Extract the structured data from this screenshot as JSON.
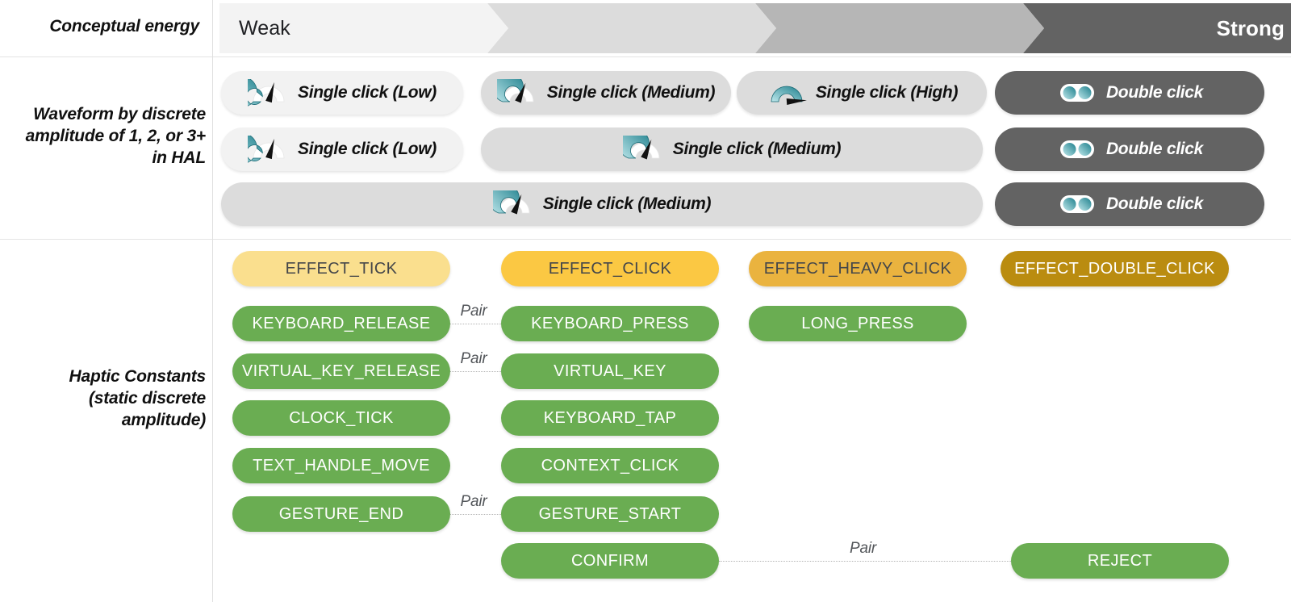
{
  "rows": {
    "energy": {
      "label": "Conceptual energy"
    },
    "waveform": {
      "label_line1": "Waveform by discrete",
      "label_line2": "amplitude of 1, 2, or 3+",
      "label_line3": "in HAL"
    },
    "constants": {
      "label_line1": "Haptic Constants",
      "label_line2": "(static discrete",
      "label_line3": "amplitude)"
    }
  },
  "energy_band": {
    "segments": [
      {
        "label": "Weak",
        "color": "#f3f3f3",
        "text_color": "#202124"
      },
      {
        "label": "",
        "color": "#dcdcdc",
        "text_color": "#202124"
      },
      {
        "label": "",
        "color": "#b6b6b6",
        "text_color": "#202124"
      },
      {
        "label": "Strong",
        "color": "#636363",
        "text_color": "#ffffff"
      }
    ]
  },
  "waveform_rows": [
    {
      "pills": [
        {
          "label": "Single click (Low)",
          "icon": "gauge-low-icon",
          "bg": "#f2f2f2",
          "tone": "light"
        },
        {
          "label": "Single click (Medium)",
          "icon": "gauge-medium-icon",
          "bg": "#dcdcdc",
          "tone": "light"
        },
        {
          "label": "Single click (High)",
          "icon": "gauge-high-icon",
          "bg": "#dcdcdc",
          "tone": "light"
        },
        {
          "label": "Double click",
          "icon": "double-click-icon",
          "bg": "#636363",
          "tone": "dark"
        }
      ]
    },
    {
      "pills": [
        {
          "label": "Single click (Low)",
          "icon": "gauge-low-icon",
          "bg": "#f2f2f2",
          "tone": "light"
        },
        {
          "label": "Single click (Medium)",
          "icon": "gauge-medium-icon",
          "bg": "#dcdcdc",
          "tone": "light"
        },
        {
          "label": "Double click",
          "icon": "double-click-icon",
          "bg": "#636363",
          "tone": "dark"
        }
      ]
    },
    {
      "pills": [
        {
          "label": "Single click (Medium)",
          "icon": "gauge-medium-icon",
          "bg": "#dcdcdc",
          "tone": "light"
        },
        {
          "label": "Double click",
          "icon": "double-click-icon",
          "bg": "#636363",
          "tone": "dark"
        }
      ]
    }
  ],
  "effect_constants": [
    {
      "label": "EFFECT_TICK",
      "bg": "#fadf8e",
      "text_color": "#45474a"
    },
    {
      "label": "EFFECT_CLICK",
      "bg": "#fbc843",
      "text_color": "#45474a"
    },
    {
      "label": "EFFECT_HEAVY_CLICK",
      "bg": "#eab33f",
      "text_color": "#45474a"
    },
    {
      "label": "EFFECT_DOUBLE_CLICK",
      "bg": "#ba8c10",
      "text_color": "#ffffff"
    }
  ],
  "haptic_constants": {
    "color": "#6aad52",
    "text_color": "#ffffff",
    "rows": [
      {
        "col1": "KEYBOARD_RELEASE",
        "col2": "KEYBOARD_PRESS",
        "col3": "LONG_PRESS",
        "col4": "",
        "pair": "Pair"
      },
      {
        "col1": "VIRTUAL_KEY_RELEASE",
        "col2": "VIRTUAL_KEY",
        "col3": "",
        "col4": "",
        "pair": "Pair"
      },
      {
        "col1": "CLOCK_TICK",
        "col2": "KEYBOARD_TAP",
        "col3": "",
        "col4": "",
        "pair": ""
      },
      {
        "col1": "TEXT_HANDLE_MOVE",
        "col2": "CONTEXT_CLICK",
        "col3": "",
        "col4": "",
        "pair": ""
      },
      {
        "col1": "GESTURE_END",
        "col2": "GESTURE_START",
        "col3": "",
        "col4": "",
        "pair": "Pair"
      },
      {
        "col1": "",
        "col2": "CONFIRM",
        "col3": "",
        "col4": "REJECT",
        "pair": "Pair"
      }
    ]
  }
}
